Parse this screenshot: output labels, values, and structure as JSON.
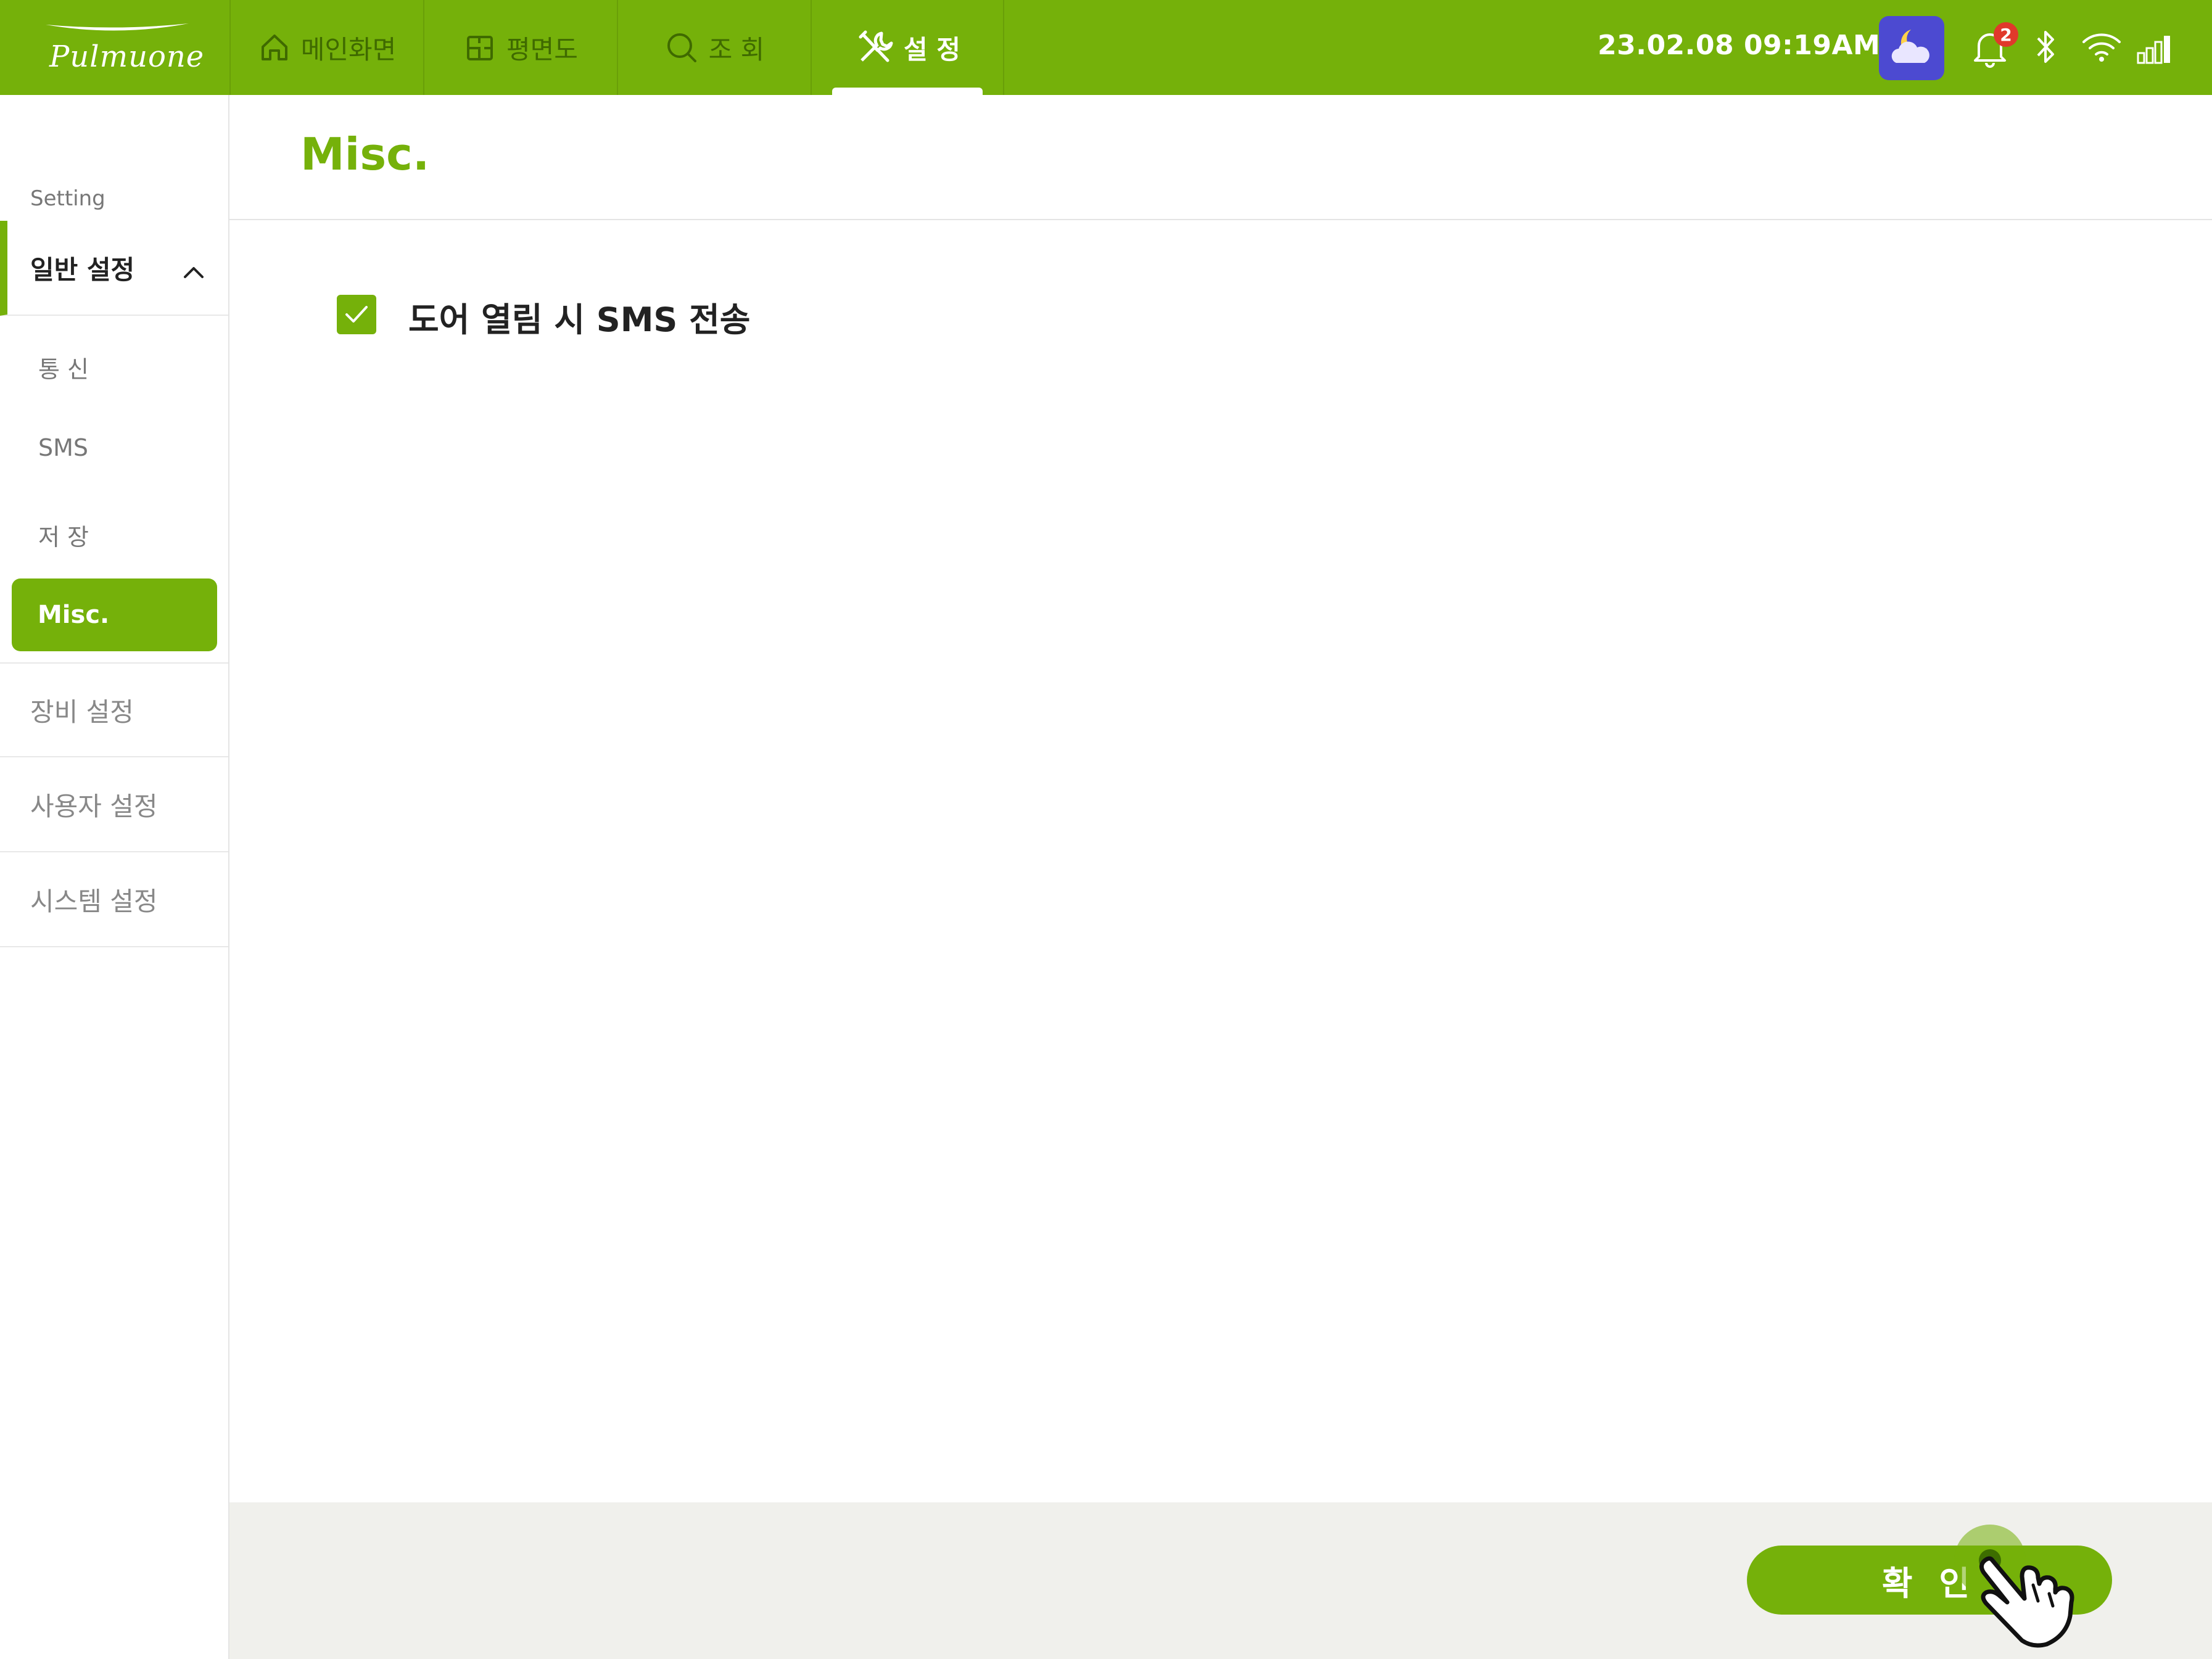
{
  "brand": {
    "logo_text": "Pulmuone",
    "accent_color": "#75b10a"
  },
  "nav": {
    "tabs": [
      {
        "label": "메인화면",
        "icon": "home-icon"
      },
      {
        "label": "평면도",
        "icon": "floorplan-icon"
      },
      {
        "label": "조 회",
        "icon": "search-icon"
      },
      {
        "label": "설 정",
        "icon": "tools-icon",
        "active": true
      }
    ]
  },
  "status": {
    "datetime": "23.02.08  09:19AM",
    "weather_icon": "moon-cloud-icon",
    "notification_count": "2",
    "icons": [
      "bell-icon",
      "bluetooth-icon",
      "wifi-icon",
      "signal-icon"
    ]
  },
  "sidebar": {
    "label": "Setting",
    "sections": [
      {
        "label": "일반 설정",
        "expanded": true,
        "items": [
          {
            "label": "통 신"
          },
          {
            "label": "SMS"
          },
          {
            "label": "저 장"
          },
          {
            "label": "Misc.",
            "active": true
          }
        ]
      },
      {
        "label": "장비 설정"
      },
      {
        "label": "사용자 설정"
      },
      {
        "label": "시스템 설정"
      }
    ]
  },
  "main": {
    "title": "Misc.",
    "options": [
      {
        "label": "도어 열림 시 SMS 전송",
        "checked": true
      }
    ]
  },
  "footer": {
    "confirm_label": "확 인"
  }
}
